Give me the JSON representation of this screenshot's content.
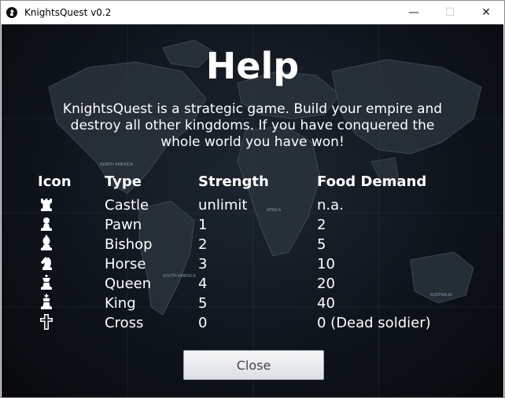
{
  "window": {
    "title": "KnightsQuest v0.2",
    "controls": {
      "minimize": "—",
      "maximize": "☐",
      "close": "✕"
    }
  },
  "help": {
    "title": "Help",
    "description": "KnightsQuest is a strategic game. Build your empire and destroy all other kingdoms. If you have conquered the whole world you have won!",
    "map_labels": [
      "NORTH AMERICA",
      "SOUTH AMERICA",
      "AFRICA",
      "AUSTRALIA"
    ]
  },
  "table": {
    "headers": {
      "icon": "Icon",
      "type": "Type",
      "strength": "Strength",
      "food": "Food Demand"
    },
    "rows": [
      {
        "icon": "castle-icon",
        "type": "Castle",
        "strength": "unlimit",
        "food": "n.a."
      },
      {
        "icon": "pawn-icon",
        "type": "Pawn",
        "strength": "1",
        "food": "2"
      },
      {
        "icon": "bishop-icon",
        "type": "Bishop",
        "strength": "2",
        "food": "5"
      },
      {
        "icon": "horse-icon",
        "type": "Horse",
        "strength": "3",
        "food": "10"
      },
      {
        "icon": "queen-icon",
        "type": "Queen",
        "strength": "4",
        "food": "20"
      },
      {
        "icon": "king-icon",
        "type": "King",
        "strength": "5",
        "food": "40"
      },
      {
        "icon": "cross-icon",
        "type": "Cross",
        "strength": "0",
        "food": "0 (Dead soldier)"
      }
    ]
  },
  "close_button": {
    "label": "Close"
  }
}
